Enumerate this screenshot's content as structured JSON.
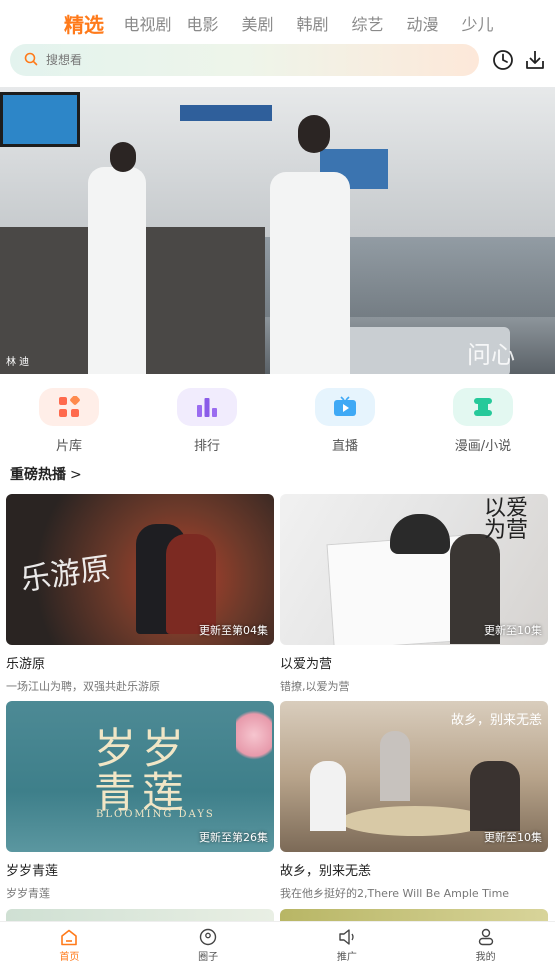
{
  "tabs": [
    "精选",
    "电视剧",
    "电影",
    "美剧",
    "韩剧",
    "综艺",
    "动漫",
    "少儿"
  ],
  "active_tab": "精选",
  "search": {
    "placeholder": "搜想看"
  },
  "banner": {
    "caption": "林 迪",
    "logo_text": "问心"
  },
  "quick_entries": [
    {
      "label": "片库",
      "icon": "grid-icon",
      "color": "#ff6a4d",
      "bg": "#ffeee8"
    },
    {
      "label": "排行",
      "icon": "bar-chart-icon",
      "color": "#9a6cf0",
      "bg": "#f1ecfd"
    },
    {
      "label": "直播",
      "icon": "live-tv-icon",
      "color": "#3fa9f5",
      "bg": "#e6f4fd"
    },
    {
      "label": "漫画/小说",
      "icon": "book-icon",
      "color": "#26c99a",
      "bg": "#e3f8f1"
    }
  ],
  "section": {
    "title": "重磅热播",
    "chevron": ">"
  },
  "cards": [
    {
      "title": "乐游原",
      "subtitle": "一场江山为聘，双强共赴乐游原",
      "badge": "更新至第04集",
      "overlay": "乐游原"
    },
    {
      "title": "以爱为营",
      "subtitle": "错撩,以爱为营",
      "badge": "更新至10集",
      "overlay": "以爱为营"
    },
    {
      "title": "岁岁青莲",
      "subtitle": "岁岁青莲",
      "badge": "更新至第26集",
      "overlay_line1": "岁岁",
      "overlay_line2": "青莲",
      "overlay_en": "BLOOMING DAYS"
    },
    {
      "title": "故乡，别来无恙",
      "subtitle": "我在他乡挺好的2,There Will Be Ample Time",
      "badge": "更新至10集",
      "overlay": "故乡，别来无恙"
    }
  ],
  "bottom_nav": [
    {
      "label": "首页",
      "icon": "home-icon",
      "active": true
    },
    {
      "label": "圈子",
      "icon": "circle-icon",
      "active": false
    },
    {
      "label": "推广",
      "icon": "speaker-icon",
      "active": false
    },
    {
      "label": "我的",
      "icon": "user-icon",
      "active": false
    }
  ],
  "colors": {
    "accent": "#ff7a1a"
  }
}
